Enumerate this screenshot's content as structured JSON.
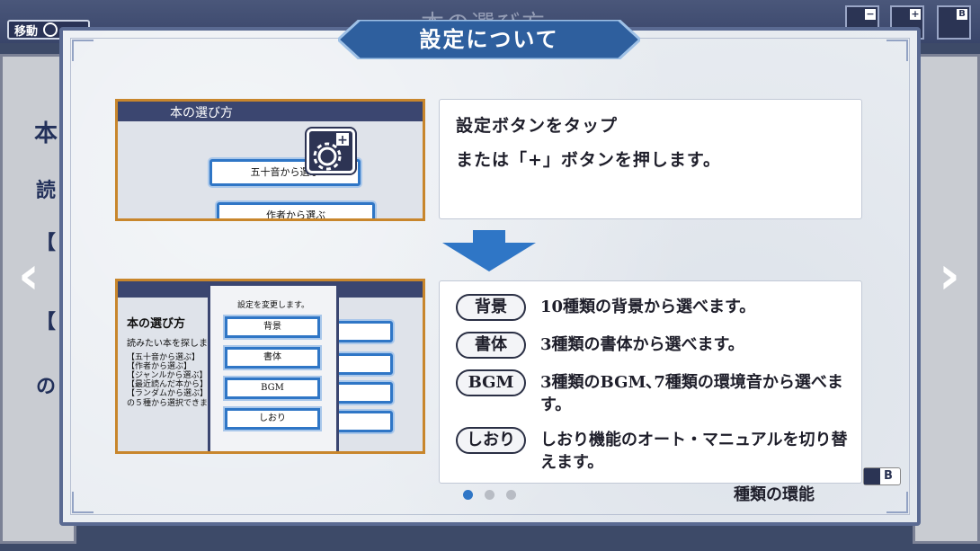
{
  "background": {
    "move_label": "移動",
    "title": "本の選び方",
    "glyphs": [
      "本",
      "読",
      "【",
      "【",
      "【",
      "【",
      "の"
    ]
  },
  "dialog": {
    "title": "設定について",
    "step1": {
      "thumb_title": "本の選び方",
      "thumb_buttons": [
        "五十音から選ぶ",
        "作者から選ぶ"
      ],
      "line1": "設定ボタンをタップ",
      "line2": "または「+」ボタンを押します。"
    },
    "step2": {
      "thumb_title": "本の選び方",
      "thumb_subtitle": "読みたい本を探します。",
      "thumb_list": [
        "【五十音から選ぶ】",
        "【作者から選ぶ】",
        "【ジャンルから選ぶ】",
        "【最近読んだ本から】",
        "【ランダムから選ぶ】"
      ],
      "thumb_footer": "の５種から選択できます",
      "menu_header": "設定を変更します。",
      "menu_items": [
        "背景",
        "書体",
        "BGM",
        "しおり"
      ],
      "rows": [
        {
          "tag": "背景",
          "text": "10種類の背景から選べます。"
        },
        {
          "tag": "書体",
          "text": "3種類の書体から選べます。"
        },
        {
          "tag": "BGM",
          "text": "3種類のBGM､7種類の環境音から選べます。"
        },
        {
          "tag": "しおり",
          "text": "しおり機能のオート・マニュアルを切り替えます。"
        }
      ]
    },
    "pagination": {
      "total": 3,
      "current": 1
    },
    "b_label": "B",
    "fragment": "種類の環能"
  },
  "colors": {
    "accent": "#2f76c6",
    "banner": "#2e5f9e",
    "frame": "#5a6a92"
  }
}
